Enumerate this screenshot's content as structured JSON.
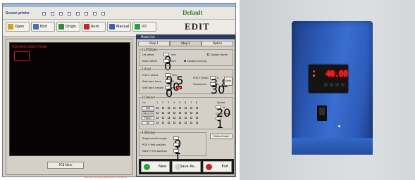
{
  "app": {
    "title_bar": "",
    "brand": "Screen printer",
    "header_title": "Default",
    "edit_title": "EDIT",
    "toolbar": [
      {
        "label": "Open",
        "icon": "folder-icon",
        "color": "#d8a020"
      },
      {
        "label": "Edit",
        "icon": "edit-icon",
        "color": "#4a6fb0"
      },
      {
        "label": "Origin",
        "icon": "origin-icon",
        "color": "#3a8a3a"
      },
      {
        "label": "Auto",
        "icon": "play-icon",
        "color": "#cc2020"
      },
      {
        "label": "Manual",
        "icon": "hand-icon",
        "color": "#3a5fb0"
      },
      {
        "label": "I/O",
        "icon": "io-icon",
        "color": "#2f9f3f"
      }
    ],
    "video_label": "PCB MARK VIDEO FRAME",
    "pcb_button": "PCB Mark",
    "footer_text": "Screen printing parameter setting"
  },
  "dialog": {
    "title": "Model Init",
    "tabs": [
      "Step 1",
      "Step 2",
      "Option"
    ],
    "group_1": {
      "label": "1.Lift/Down",
      "rows": [
        {
          "label": "Lift offset",
          "value": "0",
          "unit": "mm"
        },
        {
          "label": "Down offset",
          "value": "0",
          "unit": "mm"
        }
      ],
      "checks": [
        "Double frame",
        "Double printing"
      ]
    },
    "group_2": {
      "label": "2.Print",
      "rows": [
        {
          "label": "PCB X Offset",
          "value": "0.5",
          "unit": "mm"
        },
        {
          "label": "Side back force",
          "value": "30",
          "unit": "%"
        },
        {
          "label": "Side back Length",
          "value": "0",
          "unit": "mm"
        }
      ],
      "right_rows": [
        {
          "label": "PCB Y Offset",
          "value": "3.8",
          "unit": "%"
        },
        {
          "label": "Separation",
          "value": "30",
          "unit": "%"
        }
      ],
      "save_label": "Save",
      "set_label": "Set"
    },
    "group_3": {
      "label": "3.Cleaner",
      "columns": [
        "No",
        "1",
        "2",
        "3",
        "4",
        "5",
        "6",
        "7",
        "8"
      ],
      "rows": [
        "Wet",
        "Vacuum",
        "Paper",
        "Air"
      ],
      "speed_label": "Speed",
      "speed_value": "20",
      "speed_unit": "%",
      "clean_label": "Clean Times",
      "clean_value": "1",
      "default_button": "Default load"
    },
    "group_4": {
      "label": "4.Window",
      "rows": [
        {
          "label": "Stage overtime gap",
          "value": "0"
        },
        {
          "label": "PCB X first position",
          "value": "1"
        },
        {
          "label": "Mark Y first position",
          "value": "1"
        }
      ]
    },
    "buttons": [
      {
        "label": "New",
        "icon": "new-icon",
        "color": "#2f9f3f"
      },
      {
        "label": "Save As...",
        "icon": "save-as-icon",
        "color": "#cfcfcf"
      },
      {
        "label": "Exit",
        "icon": "exit-icon",
        "color": "#cc2020"
      }
    ]
  },
  "device": {
    "display_value": "40.00",
    "display_color": "#ff2222",
    "enclosure_color": "#2b59b6"
  }
}
